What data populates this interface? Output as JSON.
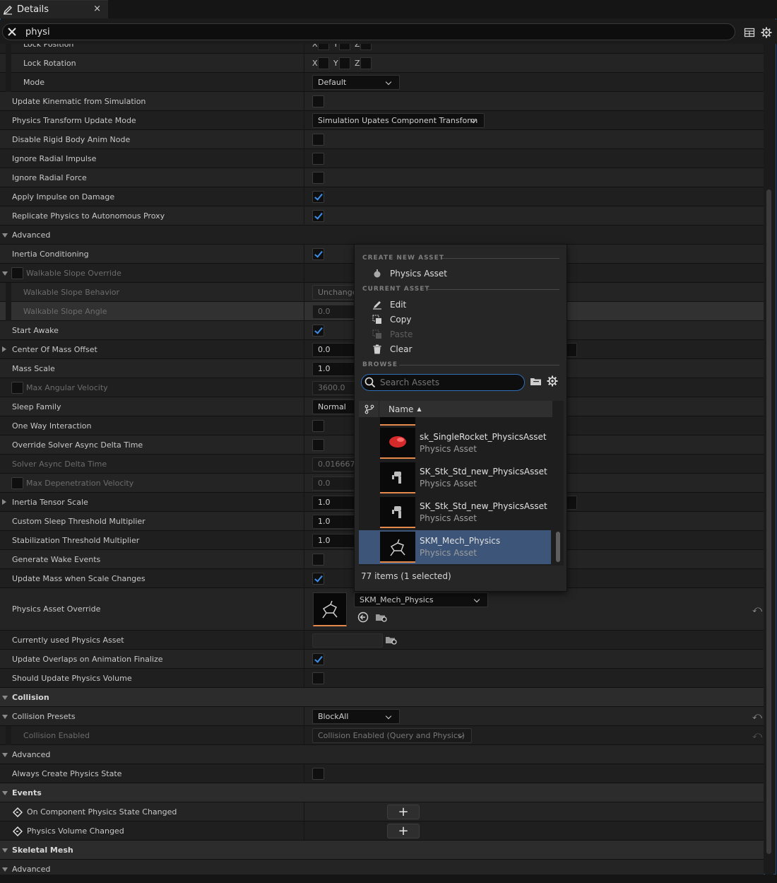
{
  "tab": {
    "label": "Details",
    "close": "×"
  },
  "search": {
    "value": "physi"
  },
  "rows": {
    "lock_position": "Lock Position",
    "lock_rotation": "Lock Rotation",
    "mode": {
      "label": "Mode",
      "value": "Default"
    },
    "update_kinematic": "Update Kinematic from Simulation",
    "transform_update_mode": {
      "label": "Physics Transform Update Mode",
      "value": "Simulation Upates Component Transform"
    },
    "disable_rigid": "Disable Rigid Body Anim Node",
    "ignore_radial_impulse": "Ignore Radial Impulse",
    "ignore_radial_force": "Ignore Radial Force",
    "apply_impulse": "Apply Impulse on Damage",
    "replicate_physics": "Replicate Physics to Autonomous Proxy",
    "advanced": "Advanced",
    "inertia_conditioning": "Inertia Conditioning",
    "walkable_slope_override": "Walkable Slope Override",
    "walkable_slope_behavior": {
      "label": "Walkable Slope Behavior",
      "value": "Unchanged"
    },
    "walkable_slope_angle": {
      "label": "Walkable Slope Angle",
      "value": "0.0"
    },
    "start_awake": "Start Awake",
    "center_of_mass": {
      "label": "Center Of Mass Offset",
      "value": "0.0"
    },
    "mass_scale": {
      "label": "Mass Scale",
      "value": "1.0"
    },
    "max_angular_velocity": {
      "label": "Max Angular Velocity",
      "value": "3600.0"
    },
    "sleep_family": {
      "label": "Sleep Family",
      "value": "Normal"
    },
    "one_way": "One Way Interaction",
    "override_solver": "Override Solver Async Delta Time",
    "solver_async": {
      "label": "Solver Async Delta Time",
      "value": "0.016667"
    },
    "max_depenetration": {
      "label": "Max Depenetration Velocity",
      "value": "0.0"
    },
    "inertia_tensor": {
      "label": "Inertia Tensor Scale",
      "value": "1.0"
    },
    "custom_sleep": {
      "label": "Custom Sleep Threshold Multiplier",
      "value": "1.0"
    },
    "stabilization": {
      "label": "Stabilization Threshold Multiplier",
      "value": "1.0"
    },
    "generate_wake": "Generate Wake Events",
    "update_mass": "Update Mass when Scale Changes",
    "physics_asset_override": {
      "label": "Physics Asset Override",
      "value": "SKM_Mech_Physics"
    },
    "currently_used": "Currently used Physics Asset",
    "update_overlaps": "Update Overlaps on Animation Finalize",
    "should_update_volume": "Should Update Physics Volume",
    "collision": "Collision",
    "collision_presets": {
      "label": "Collision Presets",
      "value": "BlockAll"
    },
    "collision_enabled": {
      "label": "Collision Enabled",
      "value": "Collision Enabled (Query and Physics)"
    },
    "advanced2": "Advanced",
    "always_create": "Always Create Physics State",
    "events": "Events",
    "on_component_changed": "On Component Physics State Changed",
    "volume_changed": "Physics Volume Changed",
    "skeletal_mesh": "Skeletal Mesh",
    "advanced3": "Advanced"
  },
  "xyz": {
    "x": "X",
    "y": "Y",
    "z": "Z"
  },
  "popup": {
    "create_new": "CREATE NEW ASSET",
    "physics_asset": "Physics Asset",
    "current_asset": "CURRENT ASSET",
    "edit": "Edit",
    "copy": "Copy",
    "paste": "Paste",
    "clear": "Clear",
    "browse": "BROWSE",
    "search_placeholder": "Search Assets",
    "column_name": "Name",
    "items": [
      {
        "name": "sk_SingleRocket_PhysicsAsset",
        "type": "Physics Asset"
      },
      {
        "name": "SK_Stk_Std_new_PhysicsAsset",
        "type": "Physics Asset"
      },
      {
        "name": "SK_Stk_Std_new_PhysicsAsset",
        "type": "Physics Asset"
      },
      {
        "name": "SKM_Mech_Physics",
        "type": "Physics Asset"
      }
    ],
    "count": "77 items (1 selected)"
  },
  "colors": {
    "accent": "#3d8ee8",
    "selection": "#3c5578",
    "thumb_border": "#e58a4c"
  }
}
